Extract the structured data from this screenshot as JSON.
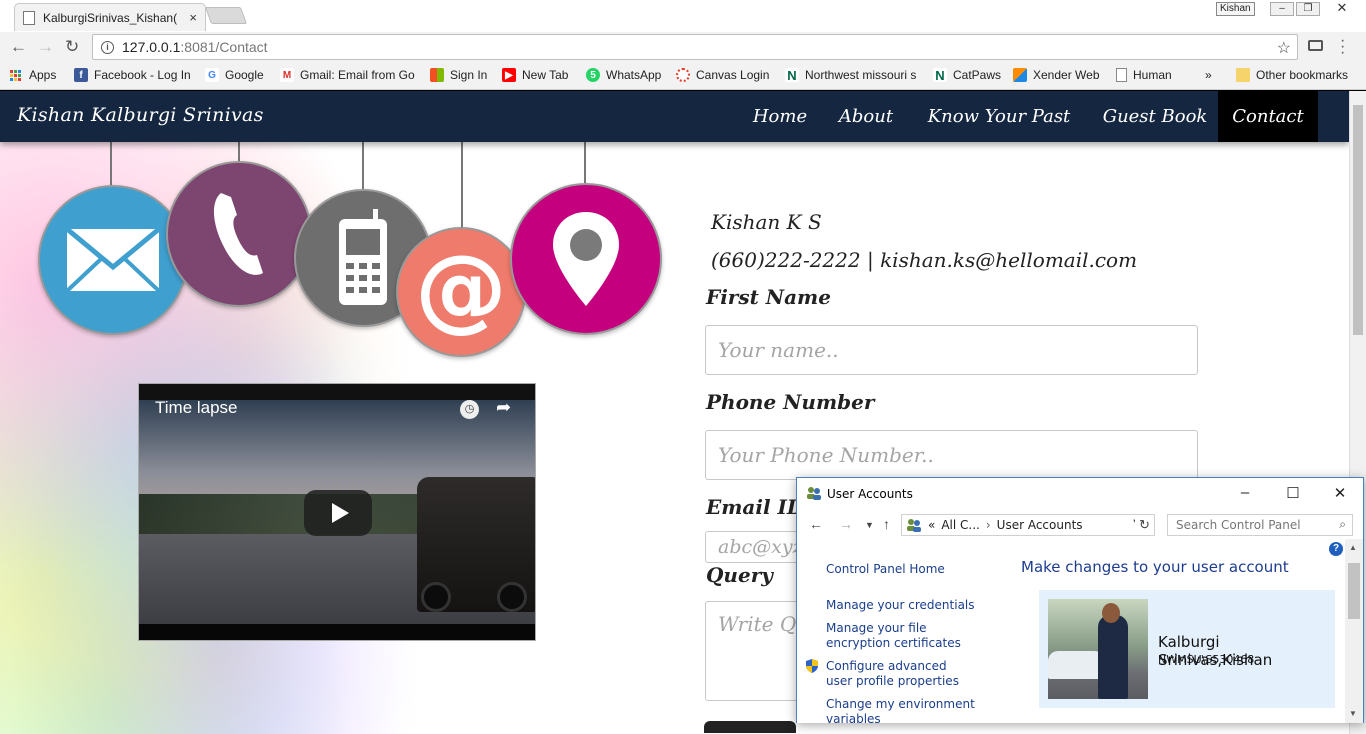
{
  "browser": {
    "tab_title": "KalburgiSrinivas_Kishan(",
    "tab_close": "×",
    "profile_name": "Kishan",
    "url_host": "127.0.0.1",
    "url_rest": ":8081/Contact",
    "bookmarks": [
      {
        "label": "Apps",
        "icon": "apps-grid-icon",
        "color": "#e53935"
      },
      {
        "label": "Facebook - Log In",
        "icon": "facebook-icon",
        "color": "#3b5998"
      },
      {
        "label": "Google",
        "icon": "google-icon",
        "color": "#4285f4"
      },
      {
        "label": "Gmail: Email from Go",
        "icon": "gmail-icon",
        "color": "#d93025"
      },
      {
        "label": "Sign In",
        "icon": "microsoft-icon",
        "color": "#f25022"
      },
      {
        "label": "New Tab",
        "icon": "youtube-icon",
        "color": "#ff0000"
      },
      {
        "label": "WhatsApp",
        "icon": "whatsapp-icon",
        "color": "#25d366"
      },
      {
        "label": "Canvas Login",
        "icon": "canvas-icon",
        "color": "#e13f2b"
      },
      {
        "label": "Northwest missouri s",
        "icon": "northwest-icon",
        "color": "#006747"
      },
      {
        "label": "CatPaws",
        "icon": "northwest-icon",
        "color": "#006747"
      },
      {
        "label": "Xender Web",
        "icon": "xender-icon",
        "color": "#ff8c00"
      },
      {
        "label": "Human",
        "icon": "page-icon",
        "color": "#888888"
      }
    ],
    "overflow_chevron": "»",
    "other_bookmarks": "Other bookmarks"
  },
  "site": {
    "brand": "Kishan Kalburgi Srinivas",
    "nav": [
      "Home",
      "About",
      "Know Your Past",
      "Guest Book",
      "Contact"
    ],
    "active_nav": "Contact",
    "contact_name": "Kishan K S",
    "contact_line": "(660)222-2222 | kishan.ks@hellomail.com",
    "form": {
      "first_name_label": "First Name",
      "first_name_placeholder": "Your name..",
      "phone_label": "Phone Number",
      "phone_placeholder": "Your Phone Number..",
      "email_label": "Email ID",
      "email_placeholder": "abc@xyz.com",
      "query_label": "Query",
      "query_placeholder": "Write Query.."
    },
    "video_title": "Time lapse",
    "bubble_colors": {
      "mail": "#3f9fcf",
      "phone": "#7d4670",
      "mobile": "#6e6e6e",
      "at": "#ee7b6c",
      "location": "#c4007f"
    }
  },
  "user_accounts": {
    "title": "User Accounts",
    "breadcrumb_prefix": "«",
    "breadcrumb_parent": "All C...",
    "breadcrumb_current": "User Accounts",
    "search_placeholder": "Search Control Panel",
    "sidebar": {
      "home": "Control Panel Home",
      "links": [
        "Manage your credentials",
        "Manage your file encryption certificates",
        "Configure advanced user profile properties",
        "Change my environment variables"
      ]
    },
    "heading": "Make changes to your user account",
    "user_name": "Kalburgi Srinivas,Kishan",
    "domain_user": "NWMSU\\S530468"
  }
}
